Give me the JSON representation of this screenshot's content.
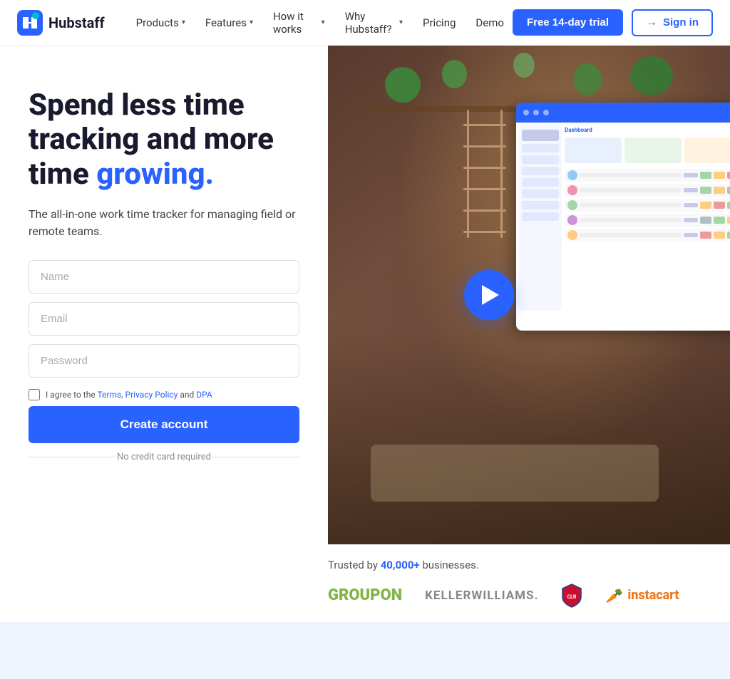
{
  "navbar": {
    "logo_text": "Hubstaff",
    "nav_items": [
      {
        "label": "Products",
        "has_dropdown": true
      },
      {
        "label": "Features",
        "has_dropdown": true
      },
      {
        "label": "How it works",
        "has_dropdown": true
      },
      {
        "label": "Why Hubstaff?",
        "has_dropdown": true
      },
      {
        "label": "Pricing",
        "has_dropdown": false
      },
      {
        "label": "Demo",
        "has_dropdown": false
      }
    ],
    "btn_trial": "Free 14-day trial",
    "btn_signin": "Sign in"
  },
  "hero": {
    "title_part1": "Spend less time tracking and more time ",
    "title_accent": "growing.",
    "subtitle": "The all-in-one work time tracker for managing field or remote teams.",
    "form": {
      "name_placeholder": "Name",
      "email_placeholder": "Email",
      "password_placeholder": "Password",
      "terms_text": "I agree to the ",
      "terms_link1": "Terms",
      "terms_separator1": ", ",
      "terms_link2": "Privacy Policy",
      "terms_separator2": " and ",
      "terms_link3": "DPA",
      "create_account_btn": "Create account",
      "no_credit_text": "No credit card required"
    }
  },
  "trusted": {
    "text_before": "Trusted by ",
    "number": "40,000+",
    "text_after": " businesses.",
    "brands": [
      {
        "name": "Groupon",
        "style": "groupon"
      },
      {
        "name": "KELLERWILLIAMS.",
        "style": "kw"
      },
      {
        "name": "Clippers",
        "style": "clippers"
      },
      {
        "name": "instacart",
        "style": "instacart"
      }
    ]
  },
  "video": {
    "aria_label": "Play video"
  }
}
